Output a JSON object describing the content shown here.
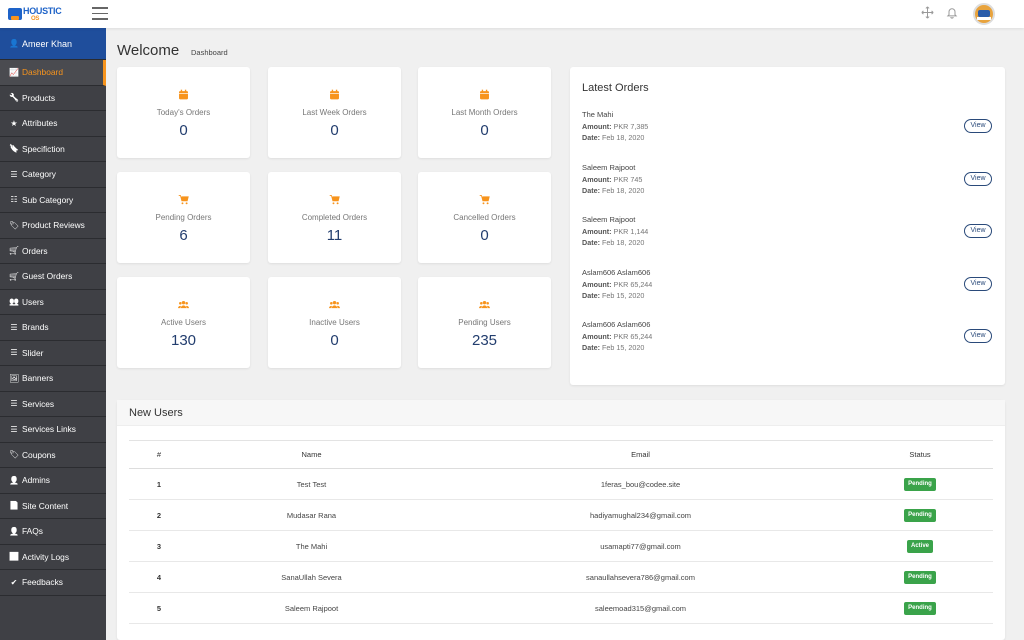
{
  "app": {
    "logo_text": "HOUSTIC",
    "logo_sub": "OS"
  },
  "sidebar": {
    "user": "Ameer Khan",
    "items": [
      {
        "label": "Dashboard",
        "icon": "chart-line-icon"
      },
      {
        "label": "Products",
        "icon": "wrench-icon"
      },
      {
        "label": "Attributes",
        "icon": "star-icon"
      },
      {
        "label": "Specifiction",
        "icon": "bookmark-icon"
      },
      {
        "label": "Category",
        "icon": "list-icon"
      },
      {
        "label": "Sub Category",
        "icon": "sitemap-icon"
      },
      {
        "label": "Product Reviews",
        "icon": "tag-icon"
      },
      {
        "label": "Orders",
        "icon": "cart-icon"
      },
      {
        "label": "Guest Orders",
        "icon": "cart-icon"
      },
      {
        "label": "Users",
        "icon": "users-icon"
      },
      {
        "label": "Brands",
        "icon": "list-icon"
      },
      {
        "label": "Slider",
        "icon": "list-icon"
      },
      {
        "label": "Banners",
        "icon": "image-icon"
      },
      {
        "label": "Services",
        "icon": "list-icon"
      },
      {
        "label": "Services Links",
        "icon": "list-icon"
      },
      {
        "label": "Coupons",
        "icon": "tag-icon"
      },
      {
        "label": "Admins",
        "icon": "user-plus-icon"
      },
      {
        "label": "Site Content",
        "icon": "file-icon"
      },
      {
        "label": "FAQs",
        "icon": "user-check-icon"
      },
      {
        "label": "Activity Logs",
        "icon": "chart-line-icon"
      },
      {
        "label": "Feedbacks",
        "icon": "check-circle-icon"
      }
    ],
    "active_index": 0
  },
  "page": {
    "title": "Welcome",
    "breadcrumb": "Dashboard"
  },
  "stats": [
    {
      "label": "Today's Orders",
      "value": "0",
      "icon": "calendar-icon"
    },
    {
      "label": "Last Week Orders",
      "value": "0",
      "icon": "calendar-icon"
    },
    {
      "label": "Last Month Orders",
      "value": "0",
      "icon": "calendar-icon"
    },
    {
      "label": "Pending Orders",
      "value": "6",
      "icon": "cart-icon"
    },
    {
      "label": "Completed Orders",
      "value": "11",
      "icon": "cart-icon"
    },
    {
      "label": "Cancelled Orders",
      "value": "0",
      "icon": "cart-icon"
    },
    {
      "label": "Active Users",
      "value": "130",
      "icon": "users-icon"
    },
    {
      "label": "Inactive Users",
      "value": "0",
      "icon": "users-icon"
    },
    {
      "label": "Pending Users",
      "value": "235",
      "icon": "users-icon"
    }
  ],
  "latest_orders": {
    "title": "Latest Orders",
    "amount_label": "Amount:",
    "date_label": "Date:",
    "view_label": "View",
    "items": [
      {
        "name": "The Mahi",
        "amount": "PKR 7,385",
        "date": "Feb 18, 2020"
      },
      {
        "name": "Saleem Rajpoot",
        "amount": "PKR 745",
        "date": "Feb 18, 2020"
      },
      {
        "name": "Saleem Rajpoot",
        "amount": "PKR 1,144",
        "date": "Feb 18, 2020"
      },
      {
        "name": "Aslam606 Aslam606",
        "amount": "PKR 65,244",
        "date": "Feb 15, 2020"
      },
      {
        "name": "Aslam606 Aslam606",
        "amount": "PKR 65,244",
        "date": "Feb 15, 2020"
      }
    ]
  },
  "new_users": {
    "title": "New Users",
    "columns": [
      "#",
      "Name",
      "Email",
      "Status"
    ],
    "rows": [
      {
        "num": "1",
        "name": "Test Test",
        "email": "1feras_bou@codee.site",
        "status": "Pending"
      },
      {
        "num": "2",
        "name": "Mudasar Rana",
        "email": "hadiyamughal234@gmail.com",
        "status": "Pending"
      },
      {
        "num": "3",
        "name": "The Mahi",
        "email": "usamapti77@gmail.com",
        "status": "Active"
      },
      {
        "num": "4",
        "name": "SanaUllah Severa",
        "email": "sanaullahsevera786@gmail.com",
        "status": "Pending"
      },
      {
        "num": "5",
        "name": "Saleem Rajpoot",
        "email": "saleemoad315@gmail.com",
        "status": "Pending"
      }
    ]
  },
  "colors": {
    "accent": "#f7941d",
    "primary": "#1f4e9c",
    "sidebar_bg": "#3f4045",
    "value_text": "#223d6e",
    "badge_green": "#3aa34a"
  }
}
